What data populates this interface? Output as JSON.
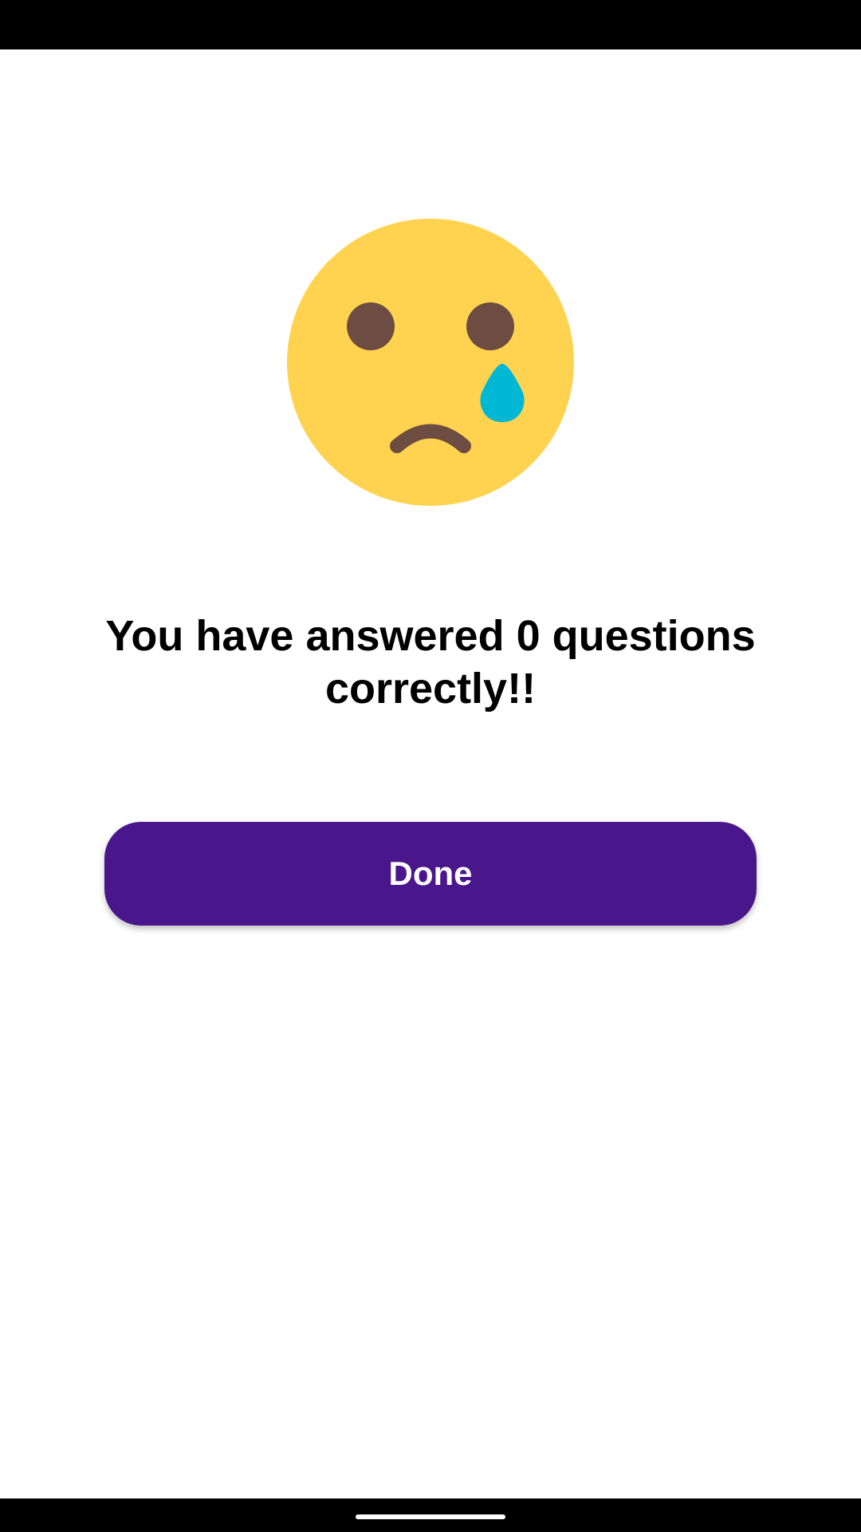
{
  "result": {
    "message": "You have answered 0 questions correctly!!",
    "icon": "crying-face-icon"
  },
  "actions": {
    "done_label": "Done"
  },
  "colors": {
    "face": "#ffd34f",
    "features": "#6d4c41",
    "tear": "#00b8d4",
    "button": "#4a168b",
    "button_text": "#ffffff"
  }
}
